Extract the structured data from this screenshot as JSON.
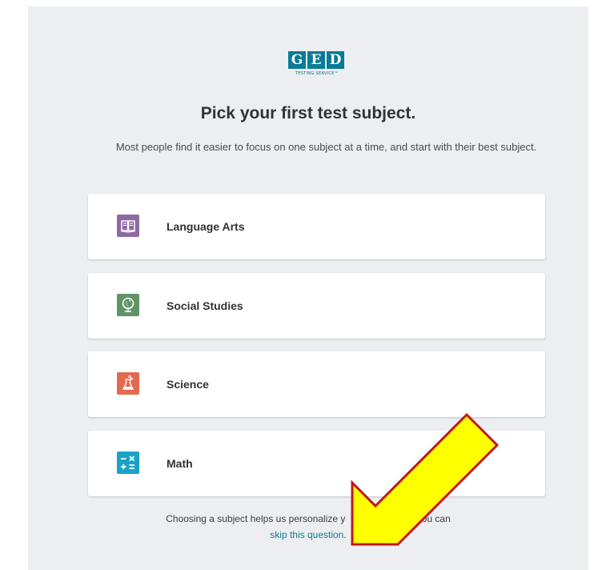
{
  "logo": {
    "letters": [
      "G",
      "E",
      "D"
    ],
    "subtitle": "TESTING SERVICE™",
    "color": "#0a7b96"
  },
  "heading": {
    "title": "Pick your first test subject.",
    "subtitle": "Most people find it easier to focus on one subject at a time, and start with their best subject."
  },
  "subjects": [
    {
      "label": "Language Arts",
      "icon": "book-icon",
      "color": "#8e6aa3"
    },
    {
      "label": "Social Studies",
      "icon": "globe-icon",
      "color": "#5f9565"
    },
    {
      "label": "Science",
      "icon": "flask-icon",
      "color": "#e36a50"
    },
    {
      "label": "Math",
      "icon": "math-operators-icon",
      "color": "#1aa3c6"
    }
  ],
  "footer": {
    "text": "Choosing a subject helps us personalize y",
    "text_after": "e, but you can",
    "link": "skip this question",
    "link_suffix": "."
  },
  "annotation": {
    "arrow_color": "#ffff00",
    "arrow_outline": "#c0181c"
  }
}
